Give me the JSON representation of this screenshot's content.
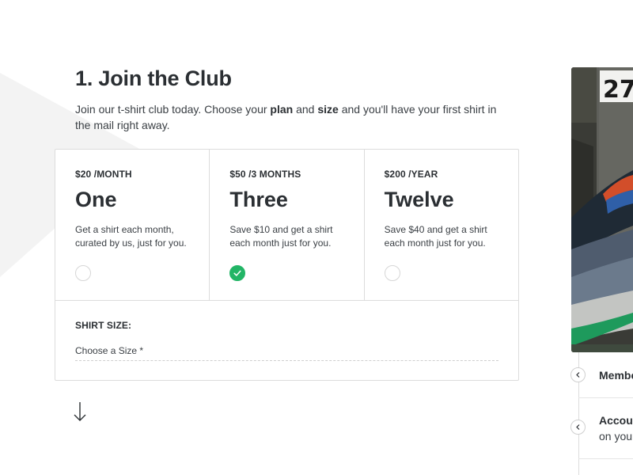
{
  "step": {
    "title": "1. Join the Club",
    "intro_start": "Join our t-shirt club today. Choose your ",
    "intro_bold1": "plan",
    "intro_mid": " and ",
    "intro_bold2": "size",
    "intro_end": " and you'll have your first shirt in the mail right away."
  },
  "plans": [
    {
      "price": "$20 /MONTH",
      "name": "One",
      "description": "Get a shirt each month, curated by us, just for you.",
      "selected": false
    },
    {
      "price": "$50 /3 MONTHS",
      "name": "Three",
      "description": "Save $10 and get a shirt each month just for you.",
      "selected": true
    },
    {
      "price": "$200 /YEAR",
      "name": "Twelve",
      "description": "Save $40 and get a shirt each month just for you.",
      "selected": false
    }
  ],
  "size": {
    "label": "SHIRT SIZE:",
    "placeholder": "Choose a Size *"
  },
  "photo": {
    "visible_number": "27"
  },
  "side_panel": {
    "items": [
      {
        "title": "Membe",
        "subtitle": ""
      },
      {
        "title": "Accou",
        "subtitle": "on your"
      }
    ]
  },
  "colors": {
    "accent": "#22b566",
    "text": "#2b2f33",
    "border": "#dcdcdc"
  },
  "icons": {
    "check": "check-icon",
    "arrow": "arrow-down-icon",
    "toggle": "chevron-left-icon"
  }
}
